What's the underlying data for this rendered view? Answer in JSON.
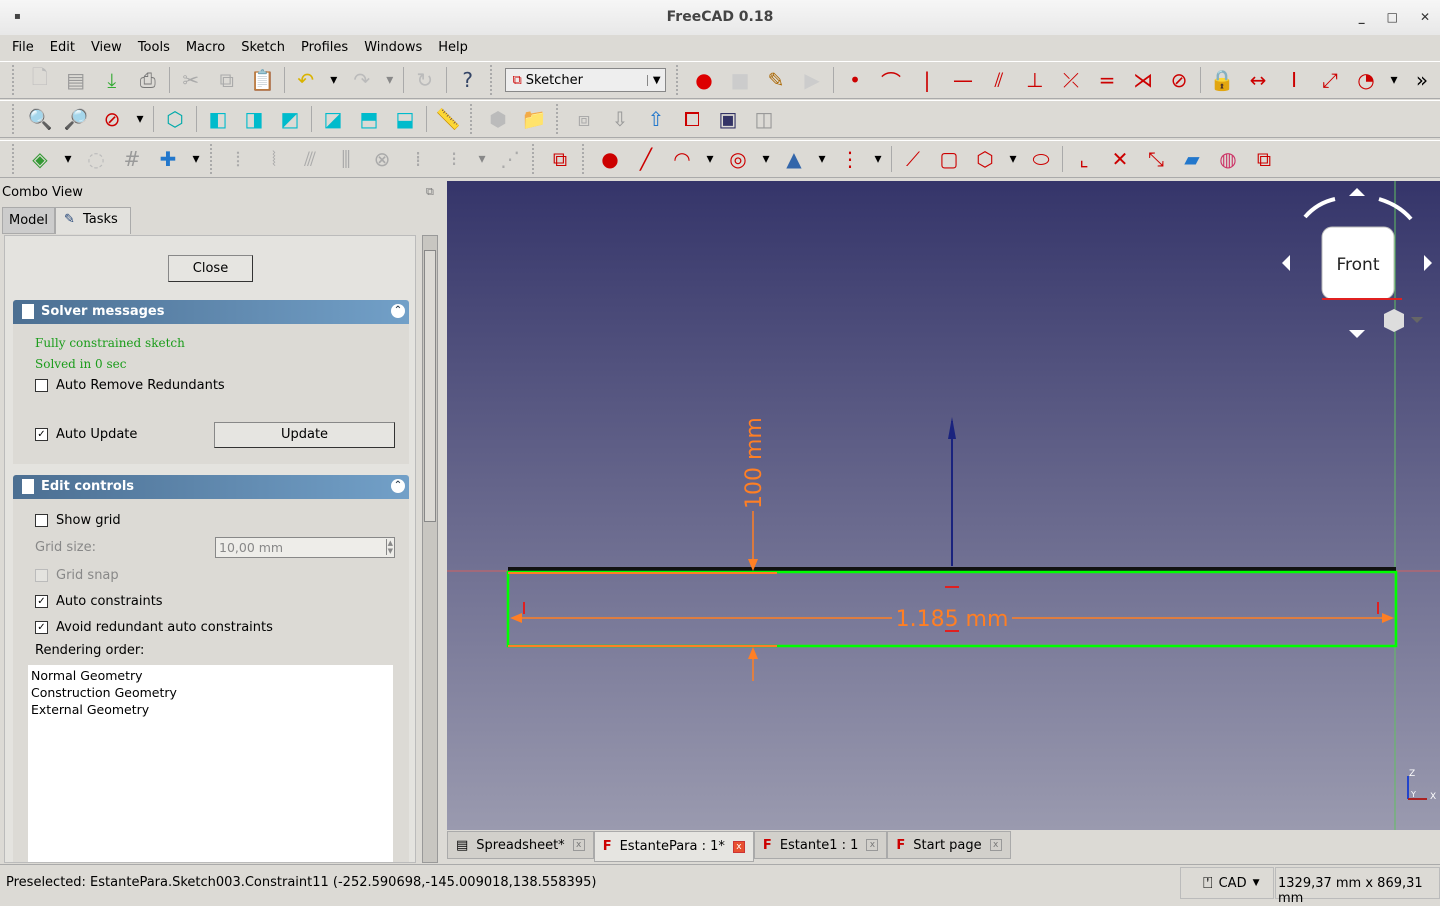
{
  "window": {
    "title": "FreeCAD 0.18",
    "minimize": "_",
    "maximize": "□",
    "close": "✕"
  },
  "menu": [
    "File",
    "Edit",
    "View",
    "Tools",
    "Macro",
    "Sketch",
    "Profiles",
    "Windows",
    "Help"
  ],
  "toolbar1": [
    {
      "icon": "new-file-icon",
      "g": "🗋",
      "c": "#bbb"
    },
    {
      "icon": "open-icon",
      "g": "▤",
      "c": "#999"
    },
    {
      "icon": "save-icon",
      "g": "⤓",
      "c": "#3a3"
    },
    {
      "icon": "print-icon",
      "g": "⎙",
      "c": "#777"
    },
    {
      "sep": true
    },
    {
      "icon": "cut-icon",
      "g": "✂",
      "c": "#aaa"
    },
    {
      "icon": "copy-icon",
      "g": "⧉",
      "c": "#aaa"
    },
    {
      "icon": "paste-icon",
      "g": "📋",
      "c": "#aaa"
    },
    {
      "sep": true
    },
    {
      "icon": "undo-icon",
      "g": "↶",
      "c": "#d9b300"
    },
    {
      "icon": "dropdown-icon",
      "g": "▾",
      "c": "#000"
    },
    {
      "icon": "redo-icon",
      "g": "↷",
      "c": "#bbb"
    },
    {
      "icon": "dropdown-icon",
      "g": "▾",
      "c": "#888"
    },
    {
      "sep": true
    },
    {
      "icon": "refresh-icon",
      "g": "↻",
      "c": "#bbb"
    },
    {
      "sep": true
    },
    {
      "icon": "whats-this-icon",
      "g": "?",
      "c": "#346"
    }
  ],
  "workbench": {
    "label": "Sketcher",
    "icon": "sketcher-icon"
  },
  "toolbar1b": [
    {
      "icon": "macro-record-icon",
      "g": "●",
      "c": "#d00"
    },
    {
      "icon": "macro-stop-icon",
      "g": "■",
      "c": "#ccc"
    },
    {
      "icon": "macro-edit-icon",
      "g": "✎",
      "c": "#a60"
    },
    {
      "icon": "macro-run-icon",
      "g": "▶",
      "c": "#ccc"
    },
    {
      "sep": true
    },
    {
      "icon": "constrain-point-icon",
      "g": "•",
      "c": "#c00"
    },
    {
      "icon": "constrain-tangent-icon",
      "g": "⌒",
      "c": "#c00"
    },
    {
      "icon": "constrain-vertical-icon",
      "g": "|",
      "c": "#c00"
    },
    {
      "icon": "constrain-horizontal-icon",
      "g": "—",
      "c": "#c00"
    },
    {
      "icon": "constrain-parallel-icon",
      "g": "⫽",
      "c": "#c00"
    },
    {
      "icon": "constrain-perpendicular-icon",
      "g": "⊥",
      "c": "#c00"
    },
    {
      "icon": "constrain-tangent2-icon",
      "g": "⤫",
      "c": "#c00"
    },
    {
      "icon": "constrain-equal-icon",
      "g": "=",
      "c": "#c00"
    },
    {
      "icon": "constrain-symmetric-icon",
      "g": "⋊",
      "c": "#c00"
    },
    {
      "icon": "constrain-block-icon",
      "g": "⊘",
      "c": "#c00"
    },
    {
      "sep": true
    },
    {
      "icon": "constrain-lock-icon",
      "g": "🔒",
      "c": "#c00"
    },
    {
      "icon": "constrain-horizontal-distance-icon",
      "g": "↔",
      "c": "#c00"
    },
    {
      "icon": "constrain-vertical-distance-icon",
      "g": "I",
      "c": "#c00"
    },
    {
      "icon": "constrain-distance-icon",
      "g": "⤢",
      "c": "#c00"
    },
    {
      "icon": "constrain-radius-icon",
      "g": "◔",
      "c": "#c00"
    },
    {
      "icon": "dropdown-icon",
      "g": "▾",
      "c": "#000"
    },
    {
      "icon": "more-icon",
      "g": "»",
      "c": "#000"
    }
  ],
  "toolbar2": [
    {
      "icon": "fit-all-icon",
      "g": "🔍",
      "c": "#07a"
    },
    {
      "icon": "fit-selection-icon",
      "g": "🔎",
      "c": "#07a"
    },
    {
      "icon": "draw-style-icon",
      "g": "⊘",
      "c": "#c00"
    },
    {
      "icon": "dropdown-icon",
      "g": "▾",
      "c": "#000"
    },
    {
      "sep": true
    },
    {
      "icon": "view-isometric-icon",
      "g": "⬡",
      "c": "#0aa"
    },
    {
      "sep": true
    },
    {
      "icon": "view-front-icon",
      "g": "◧",
      "c": "#0bc"
    },
    {
      "icon": "view-top-icon",
      "g": "◨",
      "c": "#0bc"
    },
    {
      "icon": "view-right-icon",
      "g": "◩",
      "c": "#0bc"
    },
    {
      "sep": true
    },
    {
      "icon": "view-rear-icon",
      "g": "◪",
      "c": "#0bc"
    },
    {
      "icon": "view-bottom-icon",
      "g": "⬒",
      "c": "#0bc"
    },
    {
      "icon": "view-left-icon",
      "g": "⬓",
      "c": "#0bc"
    },
    {
      "sep": true
    },
    {
      "icon": "measure-icon",
      "g": "📏",
      "c": "#aaa"
    },
    {
      "handle": true
    },
    {
      "icon": "part-icon",
      "g": "⬢",
      "c": "#bbb"
    },
    {
      "icon": "group-icon",
      "g": "📁",
      "c": "#bbb"
    },
    {
      "handle": true
    },
    {
      "icon": "new-sketch-icon",
      "g": "⧈",
      "c": "#aaa"
    },
    {
      "icon": "leave-sketch-icon",
      "g": "⇩",
      "c": "#999"
    },
    {
      "icon": "view-sketch-icon",
      "g": "⇧",
      "c": "#27c"
    },
    {
      "icon": "view-section-icon",
      "g": "⧠",
      "c": "#c00"
    },
    {
      "icon": "map-sketch-icon",
      "g": "▣",
      "c": "#336"
    },
    {
      "icon": "reorient-sketch-icon",
      "g": "◫",
      "c": "#999"
    }
  ],
  "toolbar3": [
    {
      "icon": "sketch-validate-icon",
      "g": "◈",
      "c": "#393"
    },
    {
      "icon": "dropdown-icon",
      "g": "▾",
      "c": "#000"
    },
    {
      "icon": "close-shape-icon",
      "g": "◌",
      "c": "#bbb"
    },
    {
      "icon": "grid-icon",
      "g": "#",
      "c": "#999"
    },
    {
      "icon": "select-constraints-icon",
      "g": "✚",
      "c": "#27c"
    },
    {
      "icon": "dropdown-icon",
      "g": "▾",
      "c": "#000"
    },
    {
      "handle": true
    },
    {
      "icon": "bspline-icon-1",
      "g": "⦙",
      "c": "#aaa"
    },
    {
      "icon": "bspline-icon-2",
      "g": "⦚",
      "c": "#aaa"
    },
    {
      "icon": "bspline-icon-3",
      "g": "⫻",
      "c": "#aaa"
    },
    {
      "icon": "bspline-icon-4",
      "g": "⫼",
      "c": "#aaa"
    },
    {
      "icon": "bspline-icon-5",
      "g": "⊗",
      "c": "#aaa"
    },
    {
      "icon": "bspline-icon-6",
      "g": "⁞",
      "c": "#aaa"
    },
    {
      "icon": "bspline-icon-7",
      "g": "⁝",
      "c": "#aaa"
    },
    {
      "icon": "dropdown-icon",
      "g": "▾",
      "c": "#888"
    },
    {
      "icon": "bspline-icon-8",
      "g": "⋰",
      "c": "#aaa"
    },
    {
      "handle": true
    },
    {
      "icon": "geometry-mode-icon",
      "g": "⧉",
      "c": "#c00"
    },
    {
      "handle": true
    },
    {
      "icon": "create-point-icon",
      "g": "●",
      "c": "#c00"
    },
    {
      "icon": "create-line-icon",
      "g": "╱",
      "c": "#c00"
    },
    {
      "icon": "create-arc-icon",
      "g": "◠",
      "c": "#c00"
    },
    {
      "icon": "dropdown-icon",
      "g": "▾",
      "c": "#000"
    },
    {
      "icon": "create-circle-icon",
      "g": "◎",
      "c": "#c00"
    },
    {
      "icon": "dropdown-icon",
      "g": "▾",
      "c": "#000"
    },
    {
      "icon": "create-conic-icon",
      "g": "▲",
      "c": "#36a"
    },
    {
      "icon": "dropdown-icon",
      "g": "▾",
      "c": "#000"
    },
    {
      "icon": "create-bspline-icon",
      "g": "⋮",
      "c": "#c00"
    },
    {
      "icon": "dropdown-icon",
      "g": "▾",
      "c": "#000"
    },
    {
      "sep": true
    },
    {
      "icon": "create-polyline-icon",
      "g": "⟋",
      "c": "#c00"
    },
    {
      "icon": "create-rectangle-icon",
      "g": "▢",
      "c": "#c00"
    },
    {
      "icon": "create-polygon-icon",
      "g": "⬡",
      "c": "#c00"
    },
    {
      "icon": "dropdown-icon",
      "g": "▾",
      "c": "#000"
    },
    {
      "icon": "create-slot-icon",
      "g": "⬭",
      "c": "#c00"
    },
    {
      "sep": true
    },
    {
      "icon": "fillet-icon",
      "g": "⌞",
      "c": "#c00"
    },
    {
      "icon": "trim-icon",
      "g": "✕",
      "c": "#c00"
    },
    {
      "icon": "extend-icon",
      "g": "⤡",
      "c": "#c00"
    },
    {
      "icon": "external-geometry-icon",
      "g": "▰",
      "c": "#27c"
    },
    {
      "icon": "carbon-copy-icon",
      "g": "◍",
      "c": "#c36"
    },
    {
      "icon": "construction-mode-icon",
      "g": "⧉",
      "c": "#c00"
    }
  ],
  "combo": {
    "title": "Combo View",
    "tabs": [
      "Model",
      "Tasks"
    ]
  },
  "tasks": {
    "close_label": "Close",
    "solver": {
      "title": "Solver messages",
      "status": "Fully constrained sketch",
      "time": "Solved in 0 sec",
      "auto_remove": "Auto Remove Redundants",
      "auto_remove_checked": false,
      "auto_update": "Auto Update",
      "auto_update_checked": true,
      "update_label": "Update"
    },
    "edit": {
      "title": "Edit controls",
      "show_grid": "Show grid",
      "show_grid_checked": false,
      "grid_size_label": "Grid size:",
      "grid_size_value": "10,00 mm",
      "grid_snap": "Grid snap",
      "grid_snap_checked": false,
      "auto_constraints": "Auto constraints",
      "auto_constraints_checked": true,
      "avoid_redundant": "Avoid redundant auto constraints",
      "avoid_redundant_checked": true,
      "rendering_label": "Rendering order:",
      "rendering_order": [
        "Normal Geometry",
        "Construction Geometry",
        "External Geometry"
      ]
    }
  },
  "viewport": {
    "navcube_face": "Front",
    "dim_vertical": "100 mm",
    "dim_horizontal": "1.185 mm",
    "axis_labels": {
      "z": "Z",
      "y": "Y",
      "x": "X"
    },
    "colors": {
      "geometry": "#00ff00",
      "dimension": "#ff7f24",
      "top": "#35356a",
      "bottom": "#9a9aaf"
    }
  },
  "doc_tabs": [
    {
      "label": "Spreadsheet*",
      "active": false
    },
    {
      "label": "EstantePara : 1*",
      "active": true
    },
    {
      "label": "Estante1 : 1",
      "active": false
    },
    {
      "label": "Start page",
      "active": false
    }
  ],
  "status": {
    "message": "Preselected: EstantePara.Sketch003.Constraint11 (-252.590698,-145.009018,138.558395)",
    "nav_style": "CAD",
    "dimensions": "1329,37 mm x 869,31 mm"
  }
}
